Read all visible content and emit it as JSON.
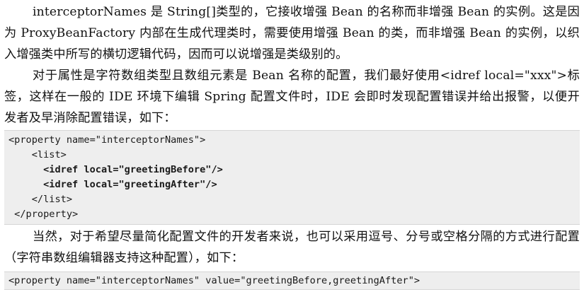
{
  "paragraphs": {
    "p1": "interceptorNames 是 String[]类型的，它接收增强 Bean 的名称而非增强 Bean 的实例。这是因为 ProxyBeanFactory 内部在生成代理类时，需要使用增强 Bean 的类，而非增强 Bean 的实例，以织入增强类中所写的横切逻辑代码，因而可以说增强是类级别的。",
    "p2": "对于属性是字符数组类型且数组元素是 Bean 名称的配置，我们最好使用<idref local=\"xxx\">标签，这样在一般的 IDE 环境下编辑 Spring 配置文件时，IDE 会即时发现配置错误并给出报警，以便开发者及早消除配置错误，如下：",
    "p3": "当然，对于希望尽量简化配置文件的开发者来说，也可以采用逗号、分号或空格分隔的方式进行配置（字符串数组编辑器支持这种配置），如下："
  },
  "code_block_1": {
    "lines": [
      "<property name=\"interceptorNames\">",
      "    <list>",
      "      <idref local=\"greetingBefore\"/>",
      "      <idref local=\"greetingAfter\"/>",
      "    </list>",
      " </property>"
    ]
  },
  "code_block_2": {
    "line": "<property name=\"interceptorNames\" value=\"greetingBefore,greetingAfter\">"
  }
}
